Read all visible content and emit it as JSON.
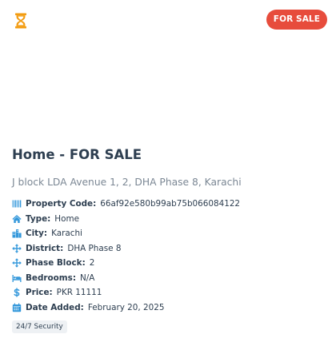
{
  "badge": {
    "label": "FOR SALE"
  },
  "listing": {
    "title": "Home - FOR SALE",
    "address": "J block LDA Avenue 1, 2, DHA Phase 8, Karachi"
  },
  "details": [
    {
      "label": "Property Code:",
      "value": "66af92e580b99ab75b066084122",
      "icon": "barcode-icon"
    },
    {
      "label": "Type:",
      "value": "Home",
      "icon": "home-icon"
    },
    {
      "label": "City:",
      "value": "Karachi",
      "icon": "city-icon"
    },
    {
      "label": "District:",
      "value": "DHA Phase 8",
      "icon": "arrows-move-icon"
    },
    {
      "label": "Phase Block:",
      "value": "2",
      "icon": "arrows-move-icon"
    },
    {
      "label": "Bedrooms:",
      "value": "N/A",
      "icon": "bed-icon"
    },
    {
      "label": "Price:",
      "value": "PKR 11111",
      "icon": "dollar-icon"
    },
    {
      "label": "Date Added:",
      "value": "February 20, 2025",
      "icon": "calendar-icon"
    }
  ],
  "amenities": [
    "24/7 Security"
  ],
  "colors": {
    "accent": "#3498db",
    "badge": "#e74c3c",
    "hourglass": "#f39c12",
    "title": "#2d3e50",
    "muted": "#7b8794"
  }
}
